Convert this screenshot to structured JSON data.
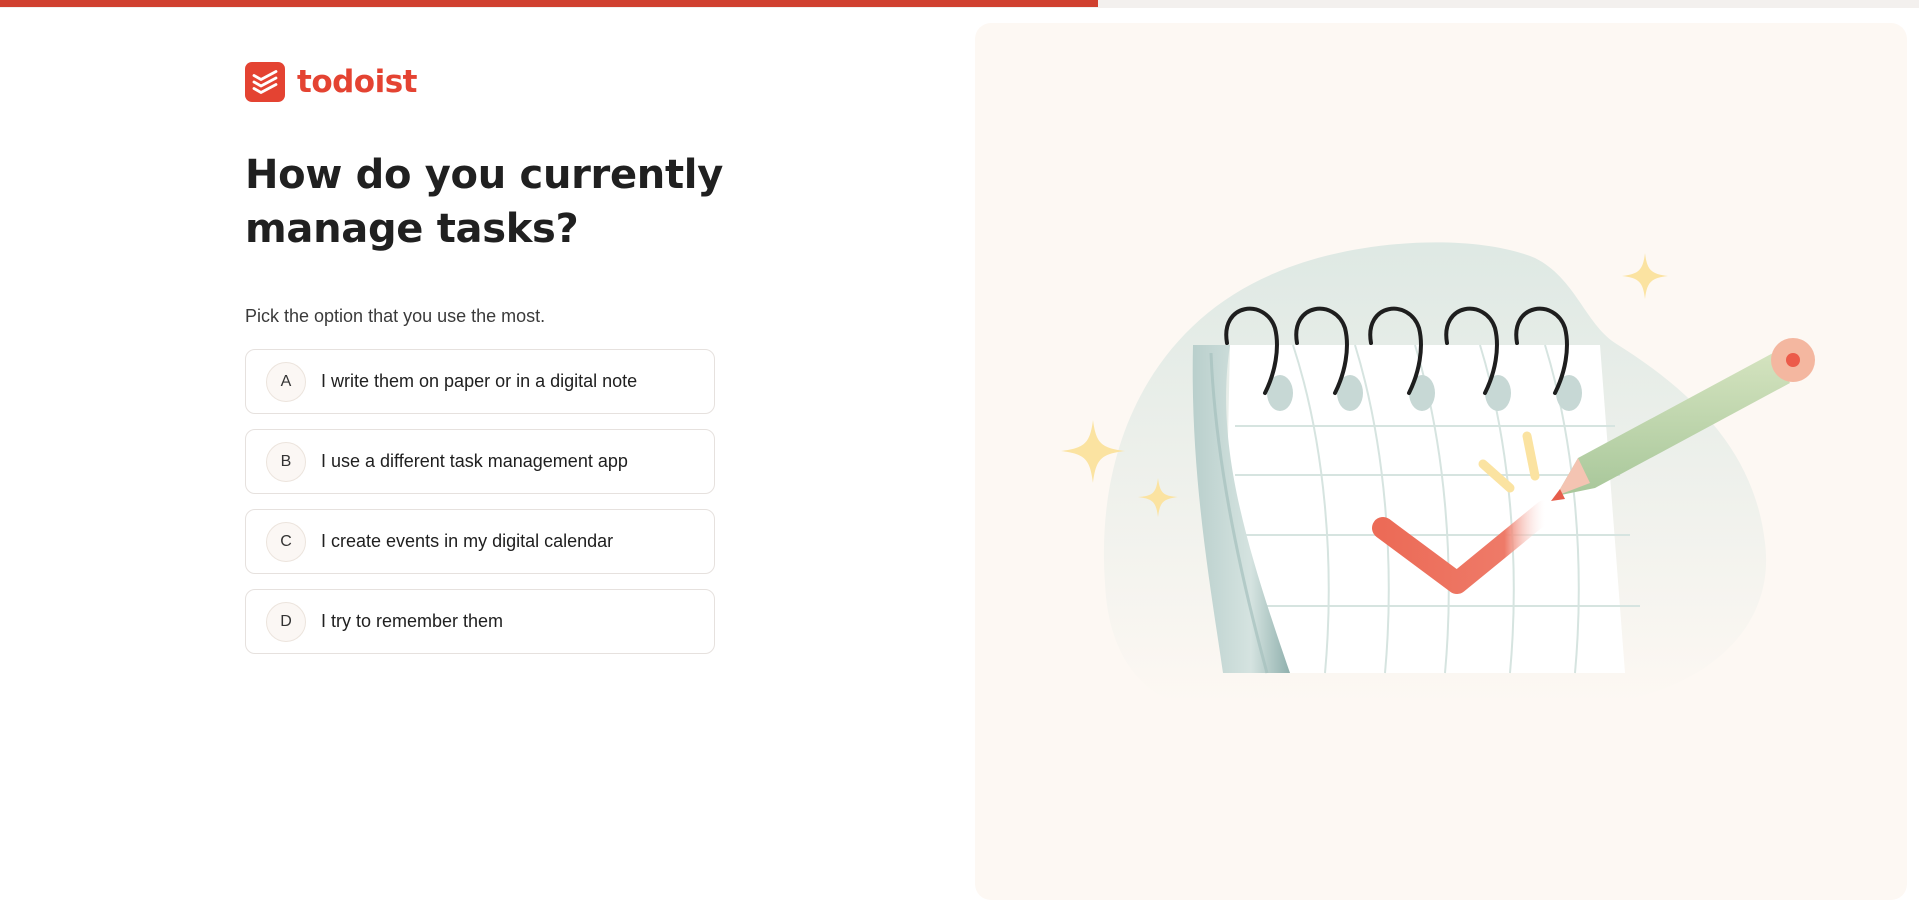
{
  "progress": {
    "value_percent": 57.2,
    "color": "#d0402f"
  },
  "logo": {
    "wordmark": "todoist",
    "icon": "todoist-layers-icon",
    "brand_color": "#e44332"
  },
  "question": {
    "heading": "How do you currently manage tasks?",
    "subtitle": "Pick the option that you use the most."
  },
  "options": [
    {
      "key": "A",
      "label": "I write them on paper or in a digital note"
    },
    {
      "key": "B",
      "label": "I use a different task management app"
    },
    {
      "key": "C",
      "label": "I create events in my digital calendar"
    },
    {
      "key": "D",
      "label": "I try to remember them"
    }
  ],
  "illustration": {
    "subject": "spiral-notepad-with-checkmark-and-pencil",
    "accent_colors": [
      "#ec6b57",
      "#c6dab0",
      "#fbe3a1",
      "#d8e5e1"
    ]
  }
}
